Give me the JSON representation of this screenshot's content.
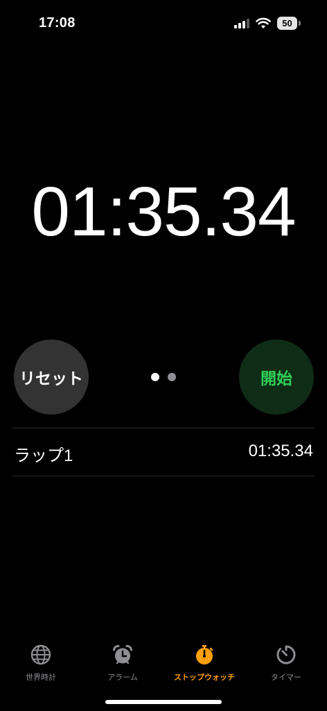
{
  "status": {
    "time": "17:08",
    "battery": "50"
  },
  "stopwatch": {
    "display": "01:35.34",
    "reset_label": "リセット",
    "start_label": "開始",
    "page_current": 1,
    "page_count": 2
  },
  "laps": [
    {
      "label": "ラップ1",
      "time": "01:35.34"
    }
  ],
  "tabs": [
    {
      "label": "世界時計",
      "icon": "globe-icon",
      "active": false
    },
    {
      "label": "アラーム",
      "icon": "alarm-clock-icon",
      "active": false
    },
    {
      "label": "ストップウォッチ",
      "icon": "stopwatch-icon",
      "active": true
    },
    {
      "label": "タイマー",
      "icon": "timer-icon",
      "active": false
    }
  ],
  "colors": {
    "background": "#000000",
    "start_text": "#30d158",
    "start_bg": "#0f2c17",
    "reset_bg": "#333333",
    "active_tab": "#ff9f0a",
    "inactive_tab": "#8e8e93"
  }
}
